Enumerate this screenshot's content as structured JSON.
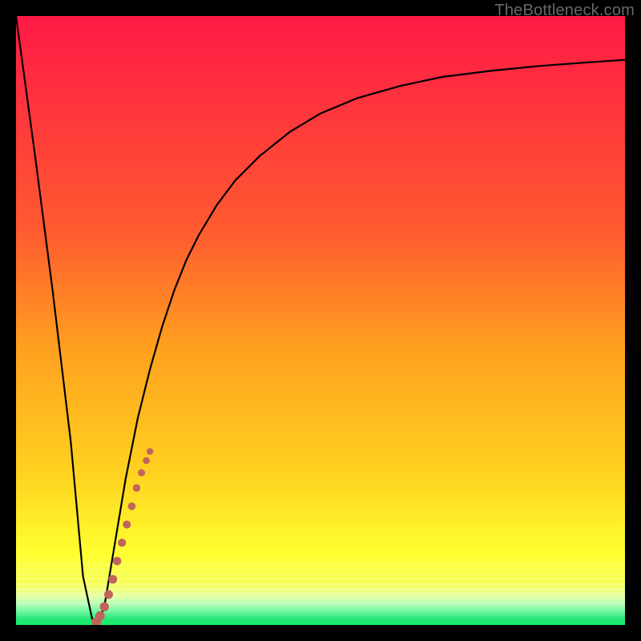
{
  "attribution": "TheBottleneck.com",
  "colors": {
    "gradient_top": "#ff1a46",
    "gradient_mid_upper": "#ff7a2a",
    "gradient_mid": "#ffd21f",
    "gradient_mid_lower": "#ffff2a",
    "gradient_bottom": "#17f06a",
    "curve": "#000000",
    "dots": "#c1645b",
    "frame": "#000000"
  },
  "chart_data": {
    "type": "line",
    "title": "",
    "xlabel": "",
    "ylabel": "",
    "xlim": [
      0,
      100
    ],
    "ylim": [
      0,
      100
    ],
    "series": [
      {
        "name": "bottleneck-curve",
        "x": [
          0,
          3,
          6,
          9,
          11,
          12.5,
          13.5,
          14.5,
          16,
          18,
          20,
          22,
          24,
          26,
          28,
          30,
          33,
          36,
          40,
          45,
          50,
          56,
          63,
          70,
          78,
          86,
          94,
          100
        ],
        "values": [
          100,
          78,
          55,
          30,
          8,
          1,
          0.5,
          3,
          12,
          24,
          34,
          42,
          49,
          55,
          60,
          64,
          69,
          73,
          77,
          81,
          84,
          86.5,
          88.5,
          90,
          91,
          91.8,
          92.4,
          92.8
        ]
      },
      {
        "name": "marker-dots",
        "x": [
          13.2,
          13.8,
          14.5,
          15.2,
          15.9,
          16.6,
          17.4,
          18.2,
          19.0,
          19.8,
          20.6,
          21.4,
          22.0
        ],
        "values": [
          0.5,
          1.5,
          3.0,
          5.0,
          7.5,
          10.5,
          13.5,
          16.5,
          19.5,
          22.5,
          25.0,
          27.0,
          28.5
        ]
      }
    ]
  }
}
